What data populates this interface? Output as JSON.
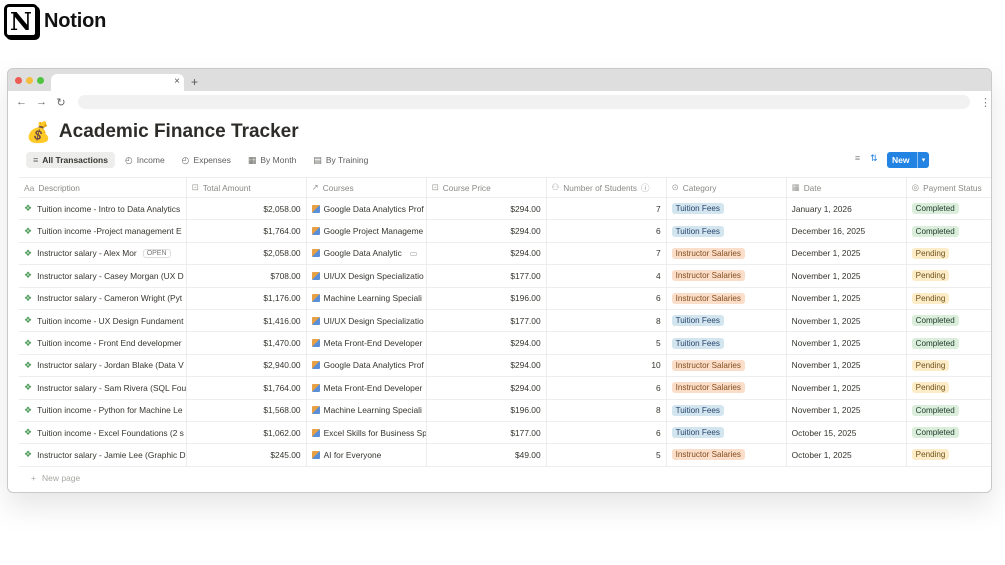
{
  "brand": {
    "name": "Notion",
    "logo_letter": "N"
  },
  "browser": {
    "tab_close": "×",
    "tab_add": "+"
  },
  "page": {
    "emoji": "💰",
    "title": "Academic Finance Tracker"
  },
  "views": [
    {
      "label": "All Transactions",
      "icon": "≡",
      "active": true
    },
    {
      "label": "Income",
      "icon": "◴"
    },
    {
      "label": "Expenses",
      "icon": "◴"
    },
    {
      "label": "By Month",
      "icon": "▦"
    },
    {
      "label": "By Training",
      "icon": "▤"
    }
  ],
  "toolbar": {
    "new_label": "New"
  },
  "columns": {
    "description": "Description",
    "total_amount": "Total Amount",
    "courses": "Courses",
    "course_price": "Course Price",
    "number_of_students": "Number of Students",
    "category": "Category",
    "date": "Date",
    "payment_status": "Payment Status"
  },
  "open_label": "OPEN",
  "rows": [
    {
      "description": "Tuition income - Intro to Data Analytics",
      "amount": "$2,058.00",
      "course": "Google Data Analytics Prof",
      "price": "$294.00",
      "students": "7",
      "category": "Tuition Fees",
      "date": "January 1, 2026",
      "status": "Completed"
    },
    {
      "description": "Tuition income -Project management E",
      "amount": "$1,764.00",
      "course": "Google Project Manageme",
      "price": "$294.00",
      "students": "6",
      "category": "Tuition Fees",
      "date": "December 16, 2025",
      "status": "Completed"
    },
    {
      "description": "Instructor salary - Alex Mor",
      "amount": "$2,058.00",
      "course": "Google Data Analytic",
      "price": "$294.00",
      "students": "7",
      "category": "Instructor Salaries",
      "date": "December 1, 2025",
      "status": "Pending"
    },
    {
      "description": "Instructor salary - Casey Morgan (UX D",
      "amount": "$708.00",
      "course": "UI/UX Design Specializatio",
      "price": "$177.00",
      "students": "4",
      "category": "Instructor Salaries",
      "date": "November 1, 2025",
      "status": "Pending"
    },
    {
      "description": "Instructor salary - Cameron Wright (Pyt",
      "amount": "$1,176.00",
      "course": "Machine Learning Speciali",
      "price": "$196.00",
      "students": "6",
      "category": "Instructor Salaries",
      "date": "November 1, 2025",
      "status": "Pending"
    },
    {
      "description": "Tuition income - UX Design Fundament",
      "amount": "$1,416.00",
      "course": "UI/UX Design Specializatio",
      "price": "$177.00",
      "students": "8",
      "category": "Tuition Fees",
      "date": "November 1, 2025",
      "status": "Completed"
    },
    {
      "description": "Tuition income - Front End developmer",
      "amount": "$1,470.00",
      "course": "Meta Front-End Developer",
      "price": "$294.00",
      "students": "5",
      "category": "Tuition Fees",
      "date": "November 1, 2025",
      "status": "Completed"
    },
    {
      "description": "Instructor salary - Jordan Blake (Data V",
      "amount": "$2,940.00",
      "course": "Google Data Analytics Prof",
      "price": "$294.00",
      "students": "10",
      "category": "Instructor Salaries",
      "date": "November 1, 2025",
      "status": "Pending"
    },
    {
      "description": "Instructor salary - Sam Rivera (SQL Fou",
      "amount": "$1,764.00",
      "course": "Meta Front-End Developer",
      "price": "$294.00",
      "students": "6",
      "category": "Instructor Salaries",
      "date": "November 1, 2025",
      "status": "Pending"
    },
    {
      "description": "Tuition income - Python for Machine Le",
      "amount": "$1,568.00",
      "course": "Machine Learning Speciali",
      "price": "$196.00",
      "students": "8",
      "category": "Tuition Fees",
      "date": "November 1, 2025",
      "status": "Completed"
    },
    {
      "description": "Tuition income - Excel Foundations (2 s",
      "amount": "$1,062.00",
      "course": "Excel Skills for Business Sp",
      "price": "$177.00",
      "students": "6",
      "category": "Tuition Fees",
      "date": "October 15, 2025",
      "status": "Completed"
    },
    {
      "description": "Instructor salary - Jamie Lee (Graphic D",
      "amount": "$245.00",
      "course": "AI for Everyone",
      "price": "$49.00",
      "students": "5",
      "category": "Instructor Salaries",
      "date": "October 1, 2025",
      "status": "Pending"
    }
  ],
  "new_page_label": "New page"
}
